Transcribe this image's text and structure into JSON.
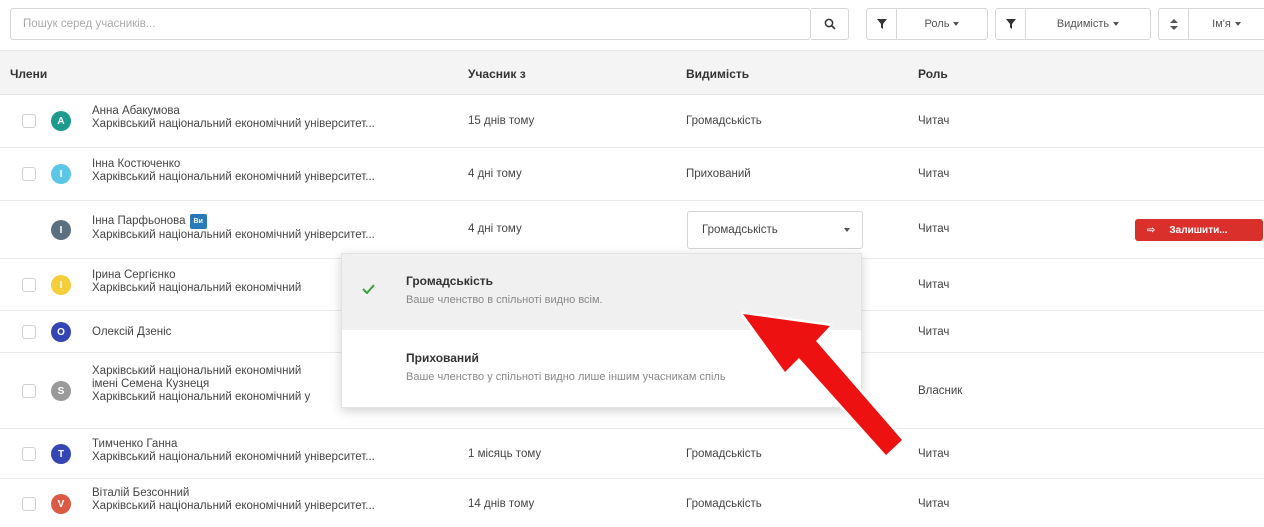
{
  "search": {
    "placeholder": "Пошук серед учасників..."
  },
  "filters": {
    "role_label": "Роль",
    "visibility_label": "Видимість",
    "sort_label": "Ім'я"
  },
  "table": {
    "headers": {
      "members": "Члени",
      "member_since": "Учасник з",
      "visibility": "Видимість",
      "role": "Роль"
    },
    "rows": [
      {
        "initial": "A",
        "color": "#1e9b8c",
        "name": "Анна Абакумова",
        "org": "Харківський національний економічний університет...",
        "since": "15 днів тому",
        "visibility": "Громадськість",
        "role": "Читач"
      },
      {
        "initial": "I",
        "color": "#5bc6e6",
        "name": "Інна Костюченко",
        "org": "Харківський національний економічний університет...",
        "since": "4 дні тому",
        "visibility": "Прихований",
        "role": "Читач"
      },
      {
        "initial": "I",
        "color": "#5a7080",
        "name": "Інна Парфьонова",
        "badge": "Ви",
        "org": "Харківський національний економічний університет...",
        "since": "4 дні тому",
        "visibility": "Громадськість",
        "role": "Читач",
        "action": "Залишити..."
      },
      {
        "initial": "I",
        "color": "#f6cd3a",
        "name": "Ірина Сергієнко",
        "org": "Харківський національний економічний",
        "role": "Читач"
      },
      {
        "initial": "O",
        "color": "#3346b3",
        "name": "Олексій Дзеніс",
        "role": "Читач"
      },
      {
        "initial": "S",
        "color": "#9a9a9a",
        "name": "Харківський національний економічний",
        "org": "імені Семена Кузнеця",
        "org2": "Харківський національний економічний у",
        "role": "Власник"
      },
      {
        "initial": "T",
        "color": "#3346b3",
        "name": "Тимченко Ганна",
        "org": "Харківський національний економічний університет...",
        "since": "1 місяць тому",
        "visibility": "Громадськість",
        "role": "Читач"
      },
      {
        "initial": "V",
        "color": "#db5a45",
        "name": "Віталій Безсонний",
        "org": "Харківський національний економічний університет...",
        "since": "14 днів тому",
        "visibility": "Громадськість",
        "role": "Читач"
      }
    ]
  },
  "visibility_dropdown": {
    "selected": "Громадськість",
    "options": [
      {
        "title": "Громадськість",
        "desc": "Ваше членство в спільноті видно всім."
      },
      {
        "title": "Прихований",
        "desc": "Ваше членство у спільноті видно лише іншим учасникам спіль"
      }
    ]
  },
  "colors": {
    "accent": "#2a7ab9",
    "danger": "#d9302b",
    "arrow": "#ee1111",
    "check": "#3a9e3a"
  },
  "icons": [
    "search-icon",
    "filter-icon",
    "sort-icon",
    "chevron-down-icon",
    "checkmark-icon",
    "exit-icon",
    "pointer-arrow"
  ]
}
